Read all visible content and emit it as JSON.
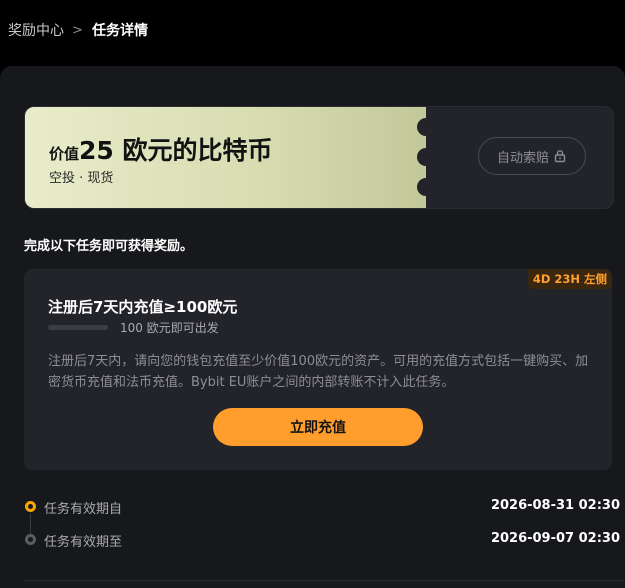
{
  "breadcrumb": {
    "root": "奖励中心",
    "separator": ">",
    "current": "任务详情"
  },
  "reward": {
    "prefix": "价值",
    "main": "25 欧元的比特币",
    "subtitle": "空投 · 现货",
    "claim_label": "自动索赔",
    "claim_icon": "lock-icon"
  },
  "instruction": "完成以下任务即可获得奖励。",
  "task": {
    "deadline_badge": "4D 23H 左侧",
    "title": "注册后7天内充值≥100欧元",
    "progress_text": "100 欧元即可出发",
    "progress_fraction": 0,
    "description": "注册后7天内，请向您的钱包充值至少价值100欧元的资产。可用的充值方式包括一键购买、加密货币充值和法币充值。Bybit EU账户之间的内部转账不计入此任务。",
    "button_label": "立即充值"
  },
  "validity": [
    {
      "label": "任务有效期自",
      "value": "2026-08-31 02:30"
    },
    {
      "label": "任务有效期至",
      "value": "2026-09-07 02:30"
    }
  ],
  "colors": {
    "accent": "#ff9e2c",
    "background": "#17181c",
    "card": "#232429"
  }
}
